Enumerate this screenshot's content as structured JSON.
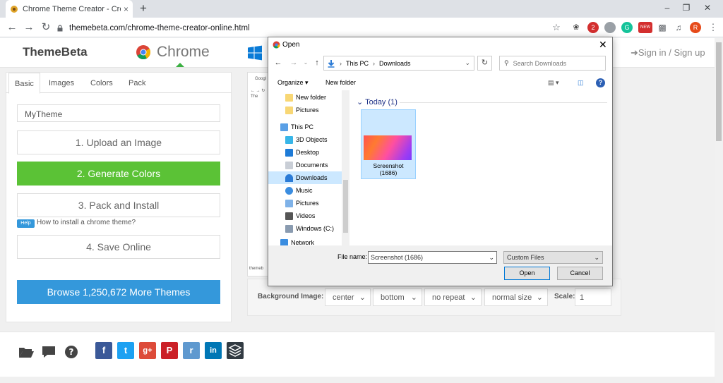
{
  "browser": {
    "tab_title": "Chrome Theme Creator - Create",
    "tab_close": "×",
    "new_tab": "+",
    "url": "themebeta.com/chrome-theme-creator-online.html",
    "profile_initial": "R",
    "ext_badge_count": "2",
    "ext_new_label": "NEW",
    "grammarly_letter": "G"
  },
  "site": {
    "brand": "ThemeBeta",
    "chrome_label": "Chrome",
    "signin": "Sign in / Sign up",
    "tabs": [
      "Basic",
      "Images",
      "Colors",
      "Pack"
    ],
    "theme_name": "MyTheme",
    "upload_btn": "1. Upload an Image",
    "generate_btn": "2. Generate Colors",
    "pack_btn": "3. Pack and Install",
    "help_badge": "Help",
    "help_link": "How to install a chrome theme?",
    "save_btn": "4. Save Online",
    "browse_btn": "Browse 1,250,672 More Themes",
    "preview_text": [
      "Googl",
      "The",
      "themeb"
    ],
    "bg_label": "Background Image:",
    "bg_position_x": "center",
    "bg_position_y": "bottom",
    "bg_repeat": "no repeat",
    "bg_size": "normal size",
    "scale_label": "Scale:",
    "scale_value": "1",
    "social": {
      "facebook": "f",
      "twitter": "t",
      "googleplus": "g+",
      "pinterest": "P",
      "reddit": "r",
      "linkedin": "in"
    }
  },
  "dialog": {
    "title": "Open",
    "path": [
      "This PC",
      "Downloads"
    ],
    "search_placeholder": "Search Downloads",
    "organize": "Organize",
    "new_folder": "New folder",
    "nav_items": [
      {
        "label": "New folder",
        "icon": "folder"
      },
      {
        "label": "Pictures",
        "icon": "folder"
      },
      {
        "label": "This PC",
        "icon": "pc"
      },
      {
        "label": "3D Objects",
        "icon": "3d"
      },
      {
        "label": "Desktop",
        "icon": "desktop"
      },
      {
        "label": "Documents",
        "icon": "documents"
      },
      {
        "label": "Downloads",
        "icon": "downloads"
      },
      {
        "label": "Music",
        "icon": "music"
      },
      {
        "label": "Pictures",
        "icon": "pictures"
      },
      {
        "label": "Videos",
        "icon": "videos"
      },
      {
        "label": "Windows (C:)",
        "icon": "drive"
      },
      {
        "label": "Network",
        "icon": "network"
      }
    ],
    "group_label": "Today (1)",
    "file_name_line1": "Screenshot",
    "file_name_line2": "(1686)",
    "file_name_label": "File name:",
    "file_name_value": "Screenshot (1686)",
    "file_type": "Custom Files",
    "open_btn": "Open",
    "cancel_btn": "Cancel"
  },
  "colors": {
    "green": "#5bc236",
    "blue": "#3498db",
    "facebook": "#3b5998",
    "twitter": "#1da1f2",
    "googleplus": "#dd4b39",
    "pinterest": "#cb2027",
    "reddit": "#5f99cf",
    "linkedin": "#0077b5",
    "buffer": "#323b43"
  }
}
